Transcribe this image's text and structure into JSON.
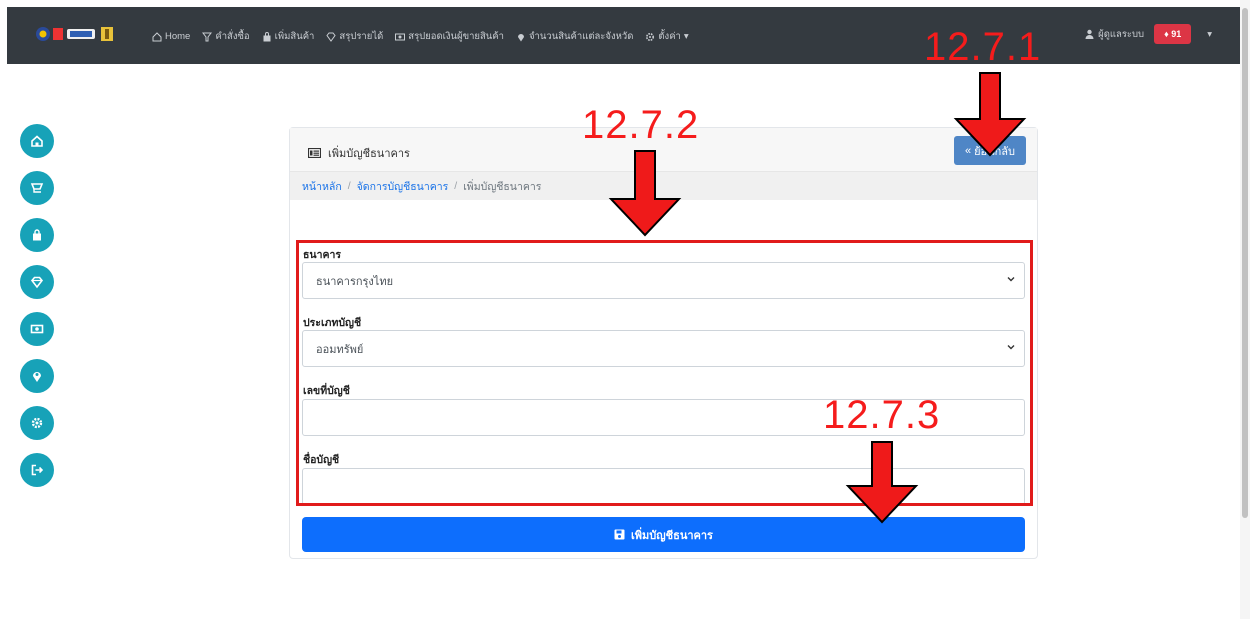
{
  "navbar": {
    "links": [
      {
        "icon": "home-icon",
        "label": "Home"
      },
      {
        "icon": "filter-icon",
        "label": "คำสั่งซื้อ"
      },
      {
        "icon": "bag-icon",
        "label": "เพิ่มสินค้า"
      },
      {
        "icon": "gem-icon",
        "label": "สรุปรายได้"
      },
      {
        "icon": "money-icon",
        "label": "สรุปยอดเงินผู้ขายสินค้า"
      },
      {
        "icon": "pin-icon",
        "label": "จำนวนสินค้าแต่ละจังหวัด"
      },
      {
        "icon": "gear-icon",
        "label": "ตั้งค่า"
      }
    ],
    "user_label": "ผู้ดูแลระบบ",
    "notification_label": "91"
  },
  "sidebar": {
    "items": [
      "home-icon",
      "cart-icon",
      "bag-icon",
      "gem-icon",
      "money-icon",
      "pin-icon",
      "gear-icon",
      "logout-icon"
    ]
  },
  "card": {
    "title": "เพิ่มบัญชีธนาคาร",
    "back_label": "ย้อนกลับ",
    "breadcrumb": {
      "home": "หน้าหลัก",
      "manage": "จัดการบัญชีธนาคาร",
      "current": "เพิ่มบัญชีธนาคาร"
    },
    "fields": {
      "bank_label": "ธนาคาร",
      "bank_value": "ธนาคารกรุงไทย",
      "type_label": "ประเภทบัญชี",
      "type_value": "ออมทรัพย์",
      "number_label": "เลขที่บัญชี",
      "number_value": "",
      "name_label": "ชื่อบัญชี",
      "name_value": ""
    },
    "submit_label": "เพิ่มบัญชีธนาคาร"
  },
  "annotations": {
    "back": "12.7.1",
    "form": "12.7.2",
    "submit": "12.7.3"
  },
  "colors": {
    "navbar": "#343a40",
    "sidebar_button": "#17a2b8",
    "primary": "#0d6efd",
    "annotation": "#f51c1c"
  }
}
